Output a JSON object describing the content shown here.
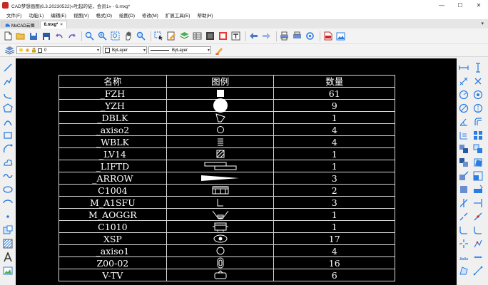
{
  "window": {
    "title": "CAD梦想画图(6.3.20230522)«吐起的徒，会员1» - 6.mxg*",
    "controls": [
      "—",
      "☐",
      "✕"
    ]
  },
  "menu": [
    "文件(F)",
    "功能(L)",
    "编辑(E)",
    "视图(V)",
    "格式(O)",
    "绘图(D)",
    "修改(M)",
    "扩展工具(E)",
    "帮助(H)"
  ],
  "tabs": [
    {
      "label": "MxCAD云图"
    },
    {
      "label": "6.mxg*",
      "active": true
    }
  ],
  "tab_menu_glyph": "▾",
  "toolbar_icons": [
    "new-file-icon",
    "open-folder-icon",
    "save-icon",
    "save-as-icon",
    "undo-icon",
    "redo-icon",
    "zoom-window-icon",
    "zoom-realtime-icon",
    "zoom-extents-icon",
    "pan-hand-icon",
    "zoom-previous-icon",
    "select-icon",
    "properties-icon",
    "layer-icon",
    "table-icon",
    "block-icon",
    "image-icon",
    "text-icon",
    "back-arrow-icon",
    "forward-arrow-icon",
    "print-icon",
    "plot-icon",
    "settings-icon",
    "pdf-icon",
    "picture-icon"
  ],
  "layerbar": {
    "layer_value": "0",
    "color_value": "ByLayer",
    "linetype_value": "ByLayer"
  },
  "table": {
    "headers": [
      "名称",
      "图例",
      "数量"
    ],
    "rows": [
      {
        "name": "_FZH",
        "symbol": "filled-square",
        "qty": "61"
      },
      {
        "name": "_YZH",
        "symbol": "filled-circle",
        "qty": "9"
      },
      {
        "name": "_DBLK",
        "symbol": "funnel",
        "qty": "1"
      },
      {
        "name": "_axiso2",
        "symbol": "small-circle",
        "qty": "4"
      },
      {
        "name": "_WBLK",
        "symbol": "stacked-lines",
        "qty": "4"
      },
      {
        "name": "_LV14",
        "symbol": "hatched-square",
        "qty": "1"
      },
      {
        "name": "_LIFTD",
        "symbol": "offset-rects",
        "qty": "1"
      },
      {
        "name": "_ARROW",
        "symbol": "long-arrow",
        "qty": "3"
      },
      {
        "name": "C1004",
        "symbol": "box-with-panels",
        "qty": "2"
      },
      {
        "name": "M_A1SFU",
        "symbol": "bracket",
        "qty": "3"
      },
      {
        "name": "M_AOGGR",
        "symbol": "chair",
        "qty": "1"
      },
      {
        "name": "C1010",
        "symbol": "device",
        "qty": "1"
      },
      {
        "name": "XSP",
        "symbol": "eye",
        "qty": "17"
      },
      {
        "name": "_axiso1",
        "symbol": "small-circle",
        "qty": "4"
      },
      {
        "name": "Z00-02",
        "symbol": "capsule",
        "qty": "16"
      },
      {
        "name": "V-TV",
        "symbol": "tv",
        "qty": "6"
      }
    ]
  }
}
